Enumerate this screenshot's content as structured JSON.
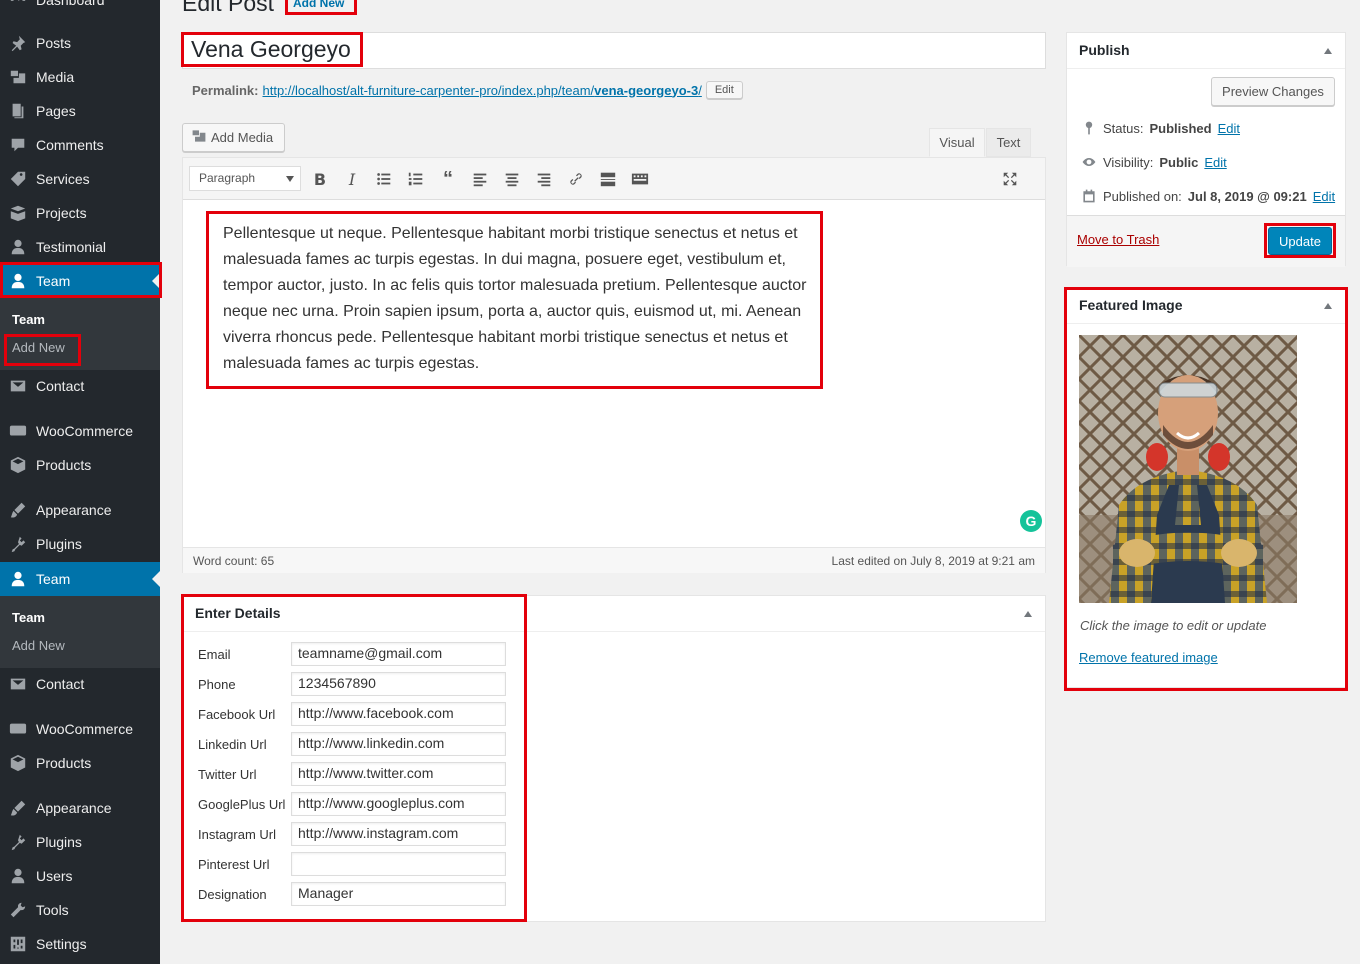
{
  "page": {
    "title": "Edit Post",
    "add_new": "Add New"
  },
  "sidebar": {
    "items": [
      {
        "label": "Dashboard",
        "icon": "dashboard-icon"
      },
      {
        "label": "Posts",
        "icon": "pin-icon"
      },
      {
        "label": "Media",
        "icon": "media-icon"
      },
      {
        "label": "Pages",
        "icon": "page-icon"
      },
      {
        "label": "Comments",
        "icon": "comment-icon"
      },
      {
        "label": "Services",
        "icon": "tag-icon"
      },
      {
        "label": "Projects",
        "icon": "portfolio-icon"
      },
      {
        "label": "Testimonial",
        "icon": "user-icon"
      },
      {
        "label": "Team",
        "icon": "user-icon"
      },
      {
        "label": "Contact",
        "icon": "email-icon"
      },
      {
        "label": "WooCommerce",
        "icon": "woo-icon"
      },
      {
        "label": "Products",
        "icon": "box-icon"
      },
      {
        "label": "Appearance",
        "icon": "brush-icon"
      },
      {
        "label": "Plugins",
        "icon": "plug-icon"
      },
      {
        "label": "Team",
        "icon": "user-icon"
      },
      {
        "label": "Contact",
        "icon": "email-icon"
      },
      {
        "label": "WooCommerce",
        "icon": "woo-icon"
      },
      {
        "label": "Products",
        "icon": "box-icon"
      },
      {
        "label": "Appearance",
        "icon": "brush-icon"
      },
      {
        "label": "Plugins",
        "icon": "plug-icon"
      },
      {
        "label": "Users",
        "icon": "user-icon"
      },
      {
        "label": "Tools",
        "icon": "wrench-icon"
      },
      {
        "label": "Settings",
        "icon": "settings-icon"
      }
    ],
    "submenu1": {
      "head": "Team",
      "item": "Add New"
    },
    "submenu2": {
      "head": "Team",
      "item": "Add New"
    }
  },
  "post": {
    "title": "Vena Georgeyo",
    "permalink_label": "Permalink:",
    "permalink_base": "http://localhost/alt-furniture-carpenter-pro/index.php/team/",
    "permalink_slug": "vena-georgeyo-3",
    "permalink_end": "/",
    "permalink_edit": "Edit"
  },
  "editor": {
    "add_media": "Add Media",
    "tab_visual": "Visual",
    "tab_text": "Text",
    "format": "Paragraph",
    "content": "Pellentesque ut neque. Pellentesque habitant morbi tristique senectus et netus et malesuada fames ac turpis egestas. In dui magna, posuere eget, vestibulum et, tempor auctor, justo. In ac felis quis tortor malesuada pretium. Pellentesque auctor neque nec urna. Proin sapien ipsum, porta a, auctor quis, euismod ut, mi. Aenean viverra rhoncus pede. Pellentesque habitant morbi tristique senectus et netus et malesuada fames ac turpis egestas.",
    "word_count": "Word count: 65",
    "last_edited": "Last edited on July 8, 2019 at 9:21 am"
  },
  "details": {
    "title": "Enter Details",
    "fields": [
      {
        "label": "Email",
        "value": "teamname@gmail.com"
      },
      {
        "label": "Phone",
        "value": "1234567890"
      },
      {
        "label": "Facebook Url",
        "value": "http://www.facebook.com"
      },
      {
        "label": "Linkedin Url",
        "value": "http://www.linkedin.com"
      },
      {
        "label": "Twitter Url",
        "value": "http://www.twitter.com"
      },
      {
        "label": "GooglePlus Url",
        "value": "http://www.googleplus.com"
      },
      {
        "label": "Instagram Url",
        "value": "http://www.instagram.com"
      },
      {
        "label": "Pinterest Url",
        "value": ""
      },
      {
        "label": "Designation",
        "value": "Manager"
      }
    ]
  },
  "publish": {
    "title": "Publish",
    "preview": "Preview Changes",
    "status_label": "Status:",
    "status_value": "Published",
    "visibility_label": "Visibility:",
    "visibility_value": "Public",
    "published_label": "Published on:",
    "published_value": "Jul 8, 2019 @ 09:21",
    "edit": "Edit",
    "trash": "Move to Trash",
    "update": "Update"
  },
  "featured": {
    "title": "Featured Image",
    "hint": "Click the image to edit or update",
    "remove": "Remove featured image"
  },
  "colors": {
    "accent": "#0073aa",
    "sidebar": "#23282d",
    "highlight": "#e3000b",
    "update": "#0085ba"
  }
}
